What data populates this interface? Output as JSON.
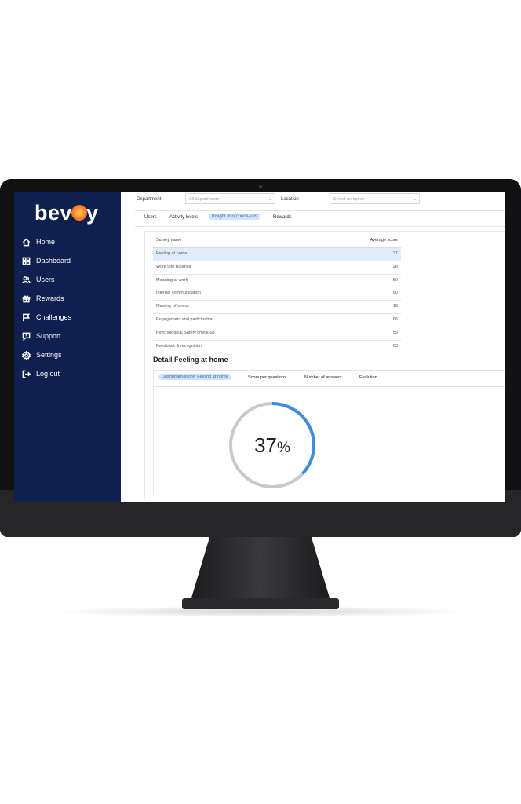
{
  "brand": {
    "name_prefix": "bev",
    "name_suffix": "y"
  },
  "sidebar": {
    "items": [
      {
        "label": "Home",
        "icon": "home-icon"
      },
      {
        "label": "Dashboard",
        "icon": "grid-icon"
      },
      {
        "label": "Users",
        "icon": "users-icon"
      },
      {
        "label": "Rewards",
        "icon": "gift-icon"
      },
      {
        "label": "Challenges",
        "icon": "flag-icon"
      },
      {
        "label": "Support",
        "icon": "chat-icon"
      },
      {
        "label": "Settings",
        "icon": "gear-icon"
      },
      {
        "label": "Log out",
        "icon": "logout-icon"
      }
    ]
  },
  "filters": {
    "department_label": "Department",
    "department_value": "All departments",
    "location_label": "Location",
    "location_placeholder": "Select an option"
  },
  "tabs": [
    "Users",
    "Activity levels",
    "Insight into check-ups",
    "Rewards"
  ],
  "active_tab": "Insight into check-ups",
  "table": {
    "col_name": "Survey name",
    "col_score": "Average score",
    "rows": [
      {
        "name": "Feeling at home",
        "score": "37"
      },
      {
        "name": "Work Life Balance",
        "score": "28"
      },
      {
        "name": "Meaning at work",
        "score": "50"
      },
      {
        "name": "Internal communication",
        "score": "80"
      },
      {
        "name": "Mastery of stress",
        "score": "18"
      },
      {
        "name": "Engagement and participation",
        "score": "66"
      },
      {
        "name": "Psychological Safety check-up",
        "score": "55"
      },
      {
        "name": "Feedback & recognition",
        "score": "63"
      }
    ]
  },
  "detail": {
    "title": "Detail Feeling at home",
    "tabs": [
      "Dashboard-score: Feeling at home",
      "Score per questions",
      "Number of answers",
      "Evolution"
    ],
    "gauge": {
      "value": 37,
      "label": "37",
      "unit": "%",
      "color": "#3b8ee0",
      "track_color": "#c8c8c8"
    }
  },
  "colors": {
    "sidebar": "#0f1f50",
    "accent": "#f26b1d",
    "highlight": "#e1ecfa"
  }
}
